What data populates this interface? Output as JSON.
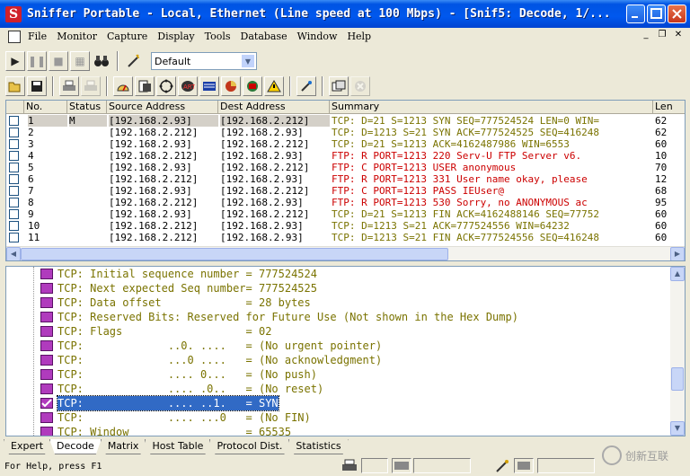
{
  "window": {
    "title": "Sniffer Portable - Local, Ethernet (Line speed at 100 Mbps) - [Snif5: Decode, 1/...",
    "app_icon_letter": "S",
    "colors": {
      "titlebar": "#0054e3",
      "selection": "#316ac5",
      "decode_text": "#7a7300",
      "ftp_text": "#cc0000"
    }
  },
  "menu": [
    "File",
    "Monitor",
    "Capture",
    "Display",
    "Tools",
    "Database",
    "Window",
    "Help"
  ],
  "toolbar": {
    "profile_value": "Default",
    "row1_icons": [
      "play-icon",
      "pause-icon",
      "stop-icon",
      "stop-and-display-icon",
      "binoculars-icon",
      "filter-wand-icon"
    ],
    "row2_icons": [
      "open-folder-icon",
      "save-icon",
      "print-icon",
      "print-preview-icon",
      "dashboard-icon",
      "host-table-icon",
      "matrix-icon",
      "art-icon",
      "protocol-dist-icon",
      "global-stats-icon",
      "alarm-log-icon",
      "warning-icon",
      "address-book-icon",
      "define-filter-icon",
      "select-filter-icon",
      "disabled-icon"
    ]
  },
  "packet_list": {
    "columns": [
      "No.",
      "Status",
      "Source Address",
      "Dest Address",
      "Summary",
      "Len"
    ],
    "rows": [
      {
        "no": "1",
        "status": "M",
        "src": "[192.168.2.93]",
        "dst": "[192.168.2.212]",
        "summary": "TCP: D=21 S=1213 SYN SEQ=777524524 LEN=0 WIN=",
        "len": "62",
        "selected": true
      },
      {
        "no": "2",
        "status": "",
        "src": "[192.168.2.212]",
        "dst": "[192.168.2.93]",
        "summary": "TCP: D=1213 S=21 SYN ACK=777524525 SEQ=416248",
        "len": "62"
      },
      {
        "no": "3",
        "status": "",
        "src": "[192.168.2.93]",
        "dst": "[192.168.2.212]",
        "summary": "TCP: D=21 S=1213      ACK=4162487986 WIN=6553",
        "len": "60"
      },
      {
        "no": "4",
        "status": "",
        "src": "[192.168.2.212]",
        "dst": "[192.168.2.93]",
        "summary": "FTP: R PORT=1213   220 Serv-U FTP Server v6.",
        "len": "10"
      },
      {
        "no": "5",
        "status": "",
        "src": "[192.168.2.93]",
        "dst": "[192.168.2.212]",
        "summary": "FTP: C PORT=1213   USER anonymous",
        "len": "70"
      },
      {
        "no": "6",
        "status": "",
        "src": "[192.168.2.212]",
        "dst": "[192.168.2.93]",
        "summary": "FTP: R PORT=1213   331 User name okay, please",
        "len": "12"
      },
      {
        "no": "7",
        "status": "",
        "src": "[192.168.2.93]",
        "dst": "[192.168.2.212]",
        "summary": "FTP: C PORT=1213   PASS IEUser@",
        "len": "68"
      },
      {
        "no": "8",
        "status": "",
        "src": "[192.168.2.212]",
        "dst": "[192.168.2.93]",
        "summary": "FTP: R PORT=1213   530 Sorry, no ANONYMOUS ac",
        "len": "95"
      },
      {
        "no": "9",
        "status": "",
        "src": "[192.168.2.93]",
        "dst": "[192.168.2.212]",
        "summary": "TCP: D=21 S=1213 FIN ACK=4162488146 SEQ=77752",
        "len": "60"
      },
      {
        "no": "10",
        "status": "",
        "src": "[192.168.2.212]",
        "dst": "[192.168.2.93]",
        "summary": "TCP: D=1213 S=21      ACK=777524556 WIN=64232",
        "len": "60"
      },
      {
        "no": "11",
        "status": "",
        "src": "[192.168.2.212]",
        "dst": "[192.168.2.93]",
        "summary": "TCP: D=1213 S=21 FIN ACK=777524556 SEQ=416248",
        "len": "60"
      }
    ]
  },
  "decode_lines": [
    {
      "text": "TCP: Initial sequence number = 777524524",
      "icon": "doc-icon"
    },
    {
      "text": "TCP: Next expected Seq number= 777524525",
      "icon": "doc-icon"
    },
    {
      "text": "TCP: Data offset             = 28 bytes",
      "icon": "doc-icon"
    },
    {
      "text": "TCP: Reserved Bits: Reserved for Future Use (Not shown in the Hex Dump)",
      "icon": "doc-icon"
    },
    {
      "text": "TCP: Flags                   = 02",
      "icon": "doc-icon"
    },
    {
      "text": "TCP:             ..0. ....   = (No urgent pointer)",
      "icon": "doc-icon"
    },
    {
      "text": "TCP:             ...0 ....   = (No acknowledgment)",
      "icon": "doc-icon"
    },
    {
      "text": "TCP:             .... 0...   = (No push)",
      "icon": "doc-icon"
    },
    {
      "text": "TCP:             .... .0..   = (No reset)",
      "icon": "doc-icon"
    },
    {
      "text": "TCP:             .... ..1.   = SYN",
      "icon": "checked-doc-icon",
      "highlight": true
    },
    {
      "text": "TCP:             .... ...0   = (No FIN)",
      "icon": "doc-icon"
    },
    {
      "text": "TCP: Window                  = 65535",
      "icon": "doc-icon"
    }
  ],
  "tabs": [
    "Expert",
    "Decode",
    "Matrix",
    "Host Table",
    "Protocol Dist.",
    "Statistics"
  ],
  "active_tab": "Decode",
  "status": {
    "text": "For Help, press F1"
  },
  "watermark": {
    "text": "创新互联"
  }
}
